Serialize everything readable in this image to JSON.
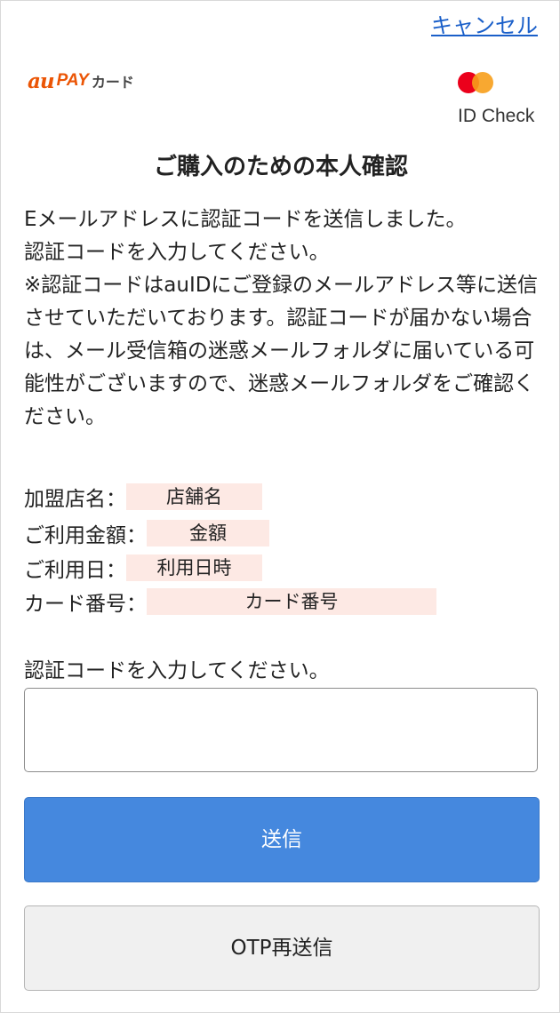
{
  "header": {
    "cancel_label": "キャンセル",
    "brand": {
      "au": "au",
      "pay": "PAY",
      "card": "カード"
    },
    "id_check_label": "ID Check"
  },
  "title": "ご購入のための本人確認",
  "message": {
    "line1": "Eメールアドレスに認証コードを送信しました。",
    "line2": "認証コードを入力してください。",
    "line3": "※認証コードはauIDにご登録のメールアドレス等に送信させていただいております。認証コードが届かない場合は、メール受信箱の迷惑メールフォルダに届いている可能性がございますので、迷惑メールフォルダをご確認ください。"
  },
  "details": {
    "merchant": {
      "label": "加盟店名：",
      "value": "店舗名"
    },
    "amount": {
      "label": "ご利用金額：",
      "value": "金額"
    },
    "date": {
      "label": "ご利用日：",
      "value": "利用日時"
    },
    "card_number": {
      "label": "カード番号：",
      "value": "カード番号"
    }
  },
  "otp": {
    "label": "認証コードを入力してください。",
    "value": "",
    "placeholder": ""
  },
  "buttons": {
    "submit": "送信",
    "resend": "OTP再送信"
  },
  "colors": {
    "link": "#1a5fc9",
    "brand_orange": "#eb5505",
    "submit_bg": "#4588de",
    "value_highlight": "#fde9e4",
    "mastercard_red": "#eb001b",
    "mastercard_yellow": "#f79e1b"
  }
}
